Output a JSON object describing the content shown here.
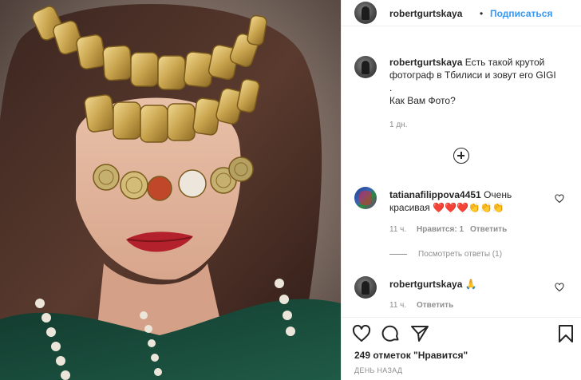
{
  "header": {
    "username": "robertgurtskaya",
    "separator": "•",
    "follow_label": "Подписаться"
  },
  "caption": {
    "username": "robertgurtskaya",
    "text_line1": "Есть такой крутой",
    "text_line2": "фотограф в Тбилиси и зовут его GIGI",
    "text_line3": ".",
    "text_line4": "Как Вам Фото?",
    "time": "1 дн."
  },
  "comments": [
    {
      "username": "tatianafilippova4451",
      "text_line1": "Очень",
      "text_line2": "красивая",
      "emoji": "❤️❤️❤️👏👏👏",
      "time": "11 ч.",
      "likes": "Нравится: 1",
      "reply_label": "Ответить",
      "view_replies": "Посмотреть ответы (1)"
    },
    {
      "username": "robertgurtskaya",
      "emoji": "🙏",
      "time": "11 ч.",
      "reply_label": "Ответить"
    }
  ],
  "post": {
    "likes_text": "249 отметок \"Нравится\"",
    "date_text": "ДЕНЬ НАЗАД"
  },
  "icons": {
    "like": "heart-icon",
    "comment": "comment-icon",
    "share": "share-icon",
    "save": "bookmark-icon",
    "load_more": "plus-circle-icon"
  },
  "colors": {
    "link_blue": "#3897f0",
    "text": "#262626",
    "muted": "#8e8e8e",
    "heart_red": "#ed4956"
  }
}
